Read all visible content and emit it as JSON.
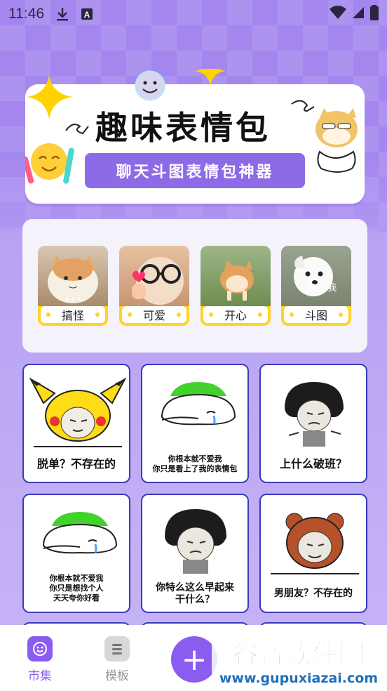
{
  "status": {
    "time": "11:46"
  },
  "banner": {
    "title": "趣味表情包",
    "subtitle": "聊天斗图表情包神器"
  },
  "categories": [
    {
      "label": "搞怪",
      "photo": "cat-icon"
    },
    {
      "label": "可爱",
      "photo": "cat-glasses-icon"
    },
    {
      "label": "开心",
      "photo": "corgi-icon"
    },
    {
      "label": "斗图",
      "photo": "dog-icon",
      "overlay": "来  打我"
    }
  ],
  "memes": [
    {
      "caption": "脱单？不存在的"
    },
    {
      "caption": "你根本就不爱我\n你只是看上了我的表情包"
    },
    {
      "caption": "上什么破班？"
    },
    {
      "caption": "你根本就不爱我\n你只是想找个人\n天天夸你好看"
    },
    {
      "caption": "你特么这么早起来\n干什么？"
    },
    {
      "caption": "男朋友？不存在的"
    }
  ],
  "nav": {
    "market": "市集",
    "templates": "模板",
    "add": "+"
  },
  "watermark": {
    "cn": "谷普软件园",
    "url": "www.gupuxiazai.com"
  },
  "colors": {
    "accent": "#8b5cf0",
    "banner_sub": "#8d6ae6",
    "card_border": "#3b3bb8",
    "tag_yellow": "#ffd428"
  }
}
